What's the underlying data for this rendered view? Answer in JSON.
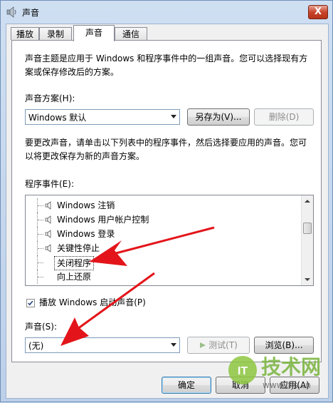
{
  "window": {
    "title": "声音",
    "close_glyph": "X"
  },
  "tabs": [
    {
      "label": "播放"
    },
    {
      "label": "录制"
    },
    {
      "label": "声音"
    },
    {
      "label": "通信"
    }
  ],
  "sound_tab": {
    "intro": [
      "声音主题是应用于 Windows 和程序事件中的一组声音。您可以选择现有方",
      "案或保存修改后的方案。"
    ],
    "scheme_label": "声音方案(H):",
    "scheme_value": "Windows 默认",
    "save_as_label": "另存为(V)...",
    "delete_label": "删除(D)",
    "instructions": [
      "要更改声音，请单击以下列表中的程序事件，然后选择要应用的声音。您可",
      "以将更改保存为新的声音方案。"
    ],
    "events_label": "程序事件(E):",
    "events": [
      {
        "label": "Windows 注销",
        "icon": "speaker-icon"
      },
      {
        "label": "Windows 用户帐户控制",
        "icon": "speaker-icon"
      },
      {
        "label": "Windows 登录",
        "icon": "speaker-icon"
      },
      {
        "label": "关键性停止",
        "icon": "speaker-icon"
      },
      {
        "label": "关闭程序",
        "icon": "",
        "selected": true
      },
      {
        "label": "向上还原",
        "icon": ""
      }
    ],
    "startup_checkbox_label": "播放 Windows 启动声音(P)",
    "startup_checked": true,
    "sound_label": "声音(S):",
    "sound_value": "(无)",
    "test_label": "测试(T)",
    "browse_label": "浏览(B)..."
  },
  "footer": {
    "ok_label": "确定",
    "cancel_label": "取消",
    "apply_label": "应用(A)"
  },
  "watermark": {
    "logo_text": "IT",
    "brand": "技术网",
    "url": "www.itjs.cn"
  },
  "colors": {
    "arrow": "#e3151a",
    "selection_border": "#333333"
  }
}
